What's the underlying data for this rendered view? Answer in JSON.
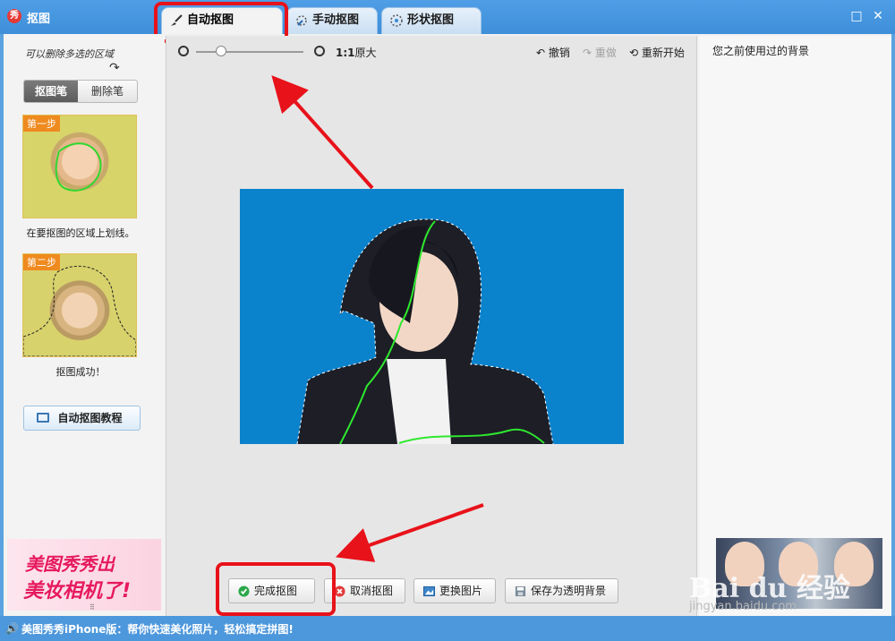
{
  "window": {
    "title": "抠图",
    "app_icon_text": "秀",
    "maximize_icon": "maximize-icon",
    "close_icon": "close-icon"
  },
  "tabs": [
    {
      "label": "自动抠图",
      "icon": "brush-icon"
    },
    {
      "label": "手动抠图",
      "icon": "pen-icon"
    },
    {
      "label": "形状抠图",
      "icon": "shape-icon"
    }
  ],
  "left_panel": {
    "hint": "可以删除多选的区域",
    "tool_on": "抠图笔",
    "tool_off": "删除笔",
    "step1_badge": "第一步",
    "step1_caption": "在要抠图的区域上划线。",
    "step2_badge": "第二步",
    "step2_caption": "抠图成功！",
    "tutorial_button": "自动抠图教程"
  },
  "toolbar": {
    "zoom_ratio": "1:1",
    "zoom_label": "原大",
    "undo": "撤销",
    "redo": "重做",
    "restart": "重新开始",
    "zoom_slider_value": 0.18
  },
  "right_panel": {
    "title": "您之前使用过的背景"
  },
  "bottom_buttons": {
    "finish": "完成抠图",
    "cancel": "取消抠图",
    "replace": "更换图片",
    "save_transparent": "保存为透明背景"
  },
  "ad": {
    "line1": "美图秀秀出",
    "line2": "美妆相机了!"
  },
  "status_bar": {
    "text": "美图秀秀iPhone版：帮你快速美化照片，轻松搞定拼图!"
  },
  "colors": {
    "accent": "#4d97dc",
    "highlight": "#e8121a",
    "canvas_bg": "#0b82cc",
    "stroke_green": "#22e322"
  }
}
